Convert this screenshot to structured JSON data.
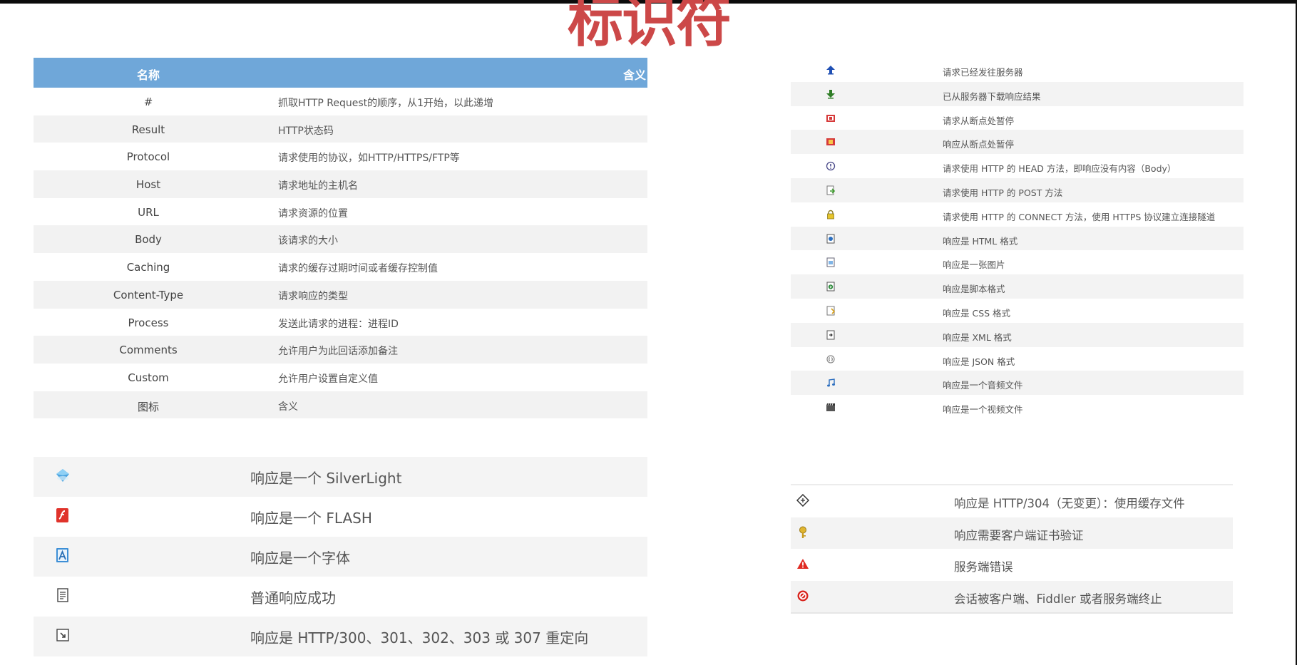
{
  "page": {
    "title": "标识符"
  },
  "columns_table": {
    "header": {
      "name": "名称",
      "meaning": "含义"
    },
    "rows": [
      {
        "name": "#",
        "desc": "抓取HTTP Request的顺序，从1开始，以此递增"
      },
      {
        "name": "Result",
        "desc": "HTTP状态码"
      },
      {
        "name": "Protocol",
        "desc": "请求使用的协议，如HTTP/HTTPS/FTP等"
      },
      {
        "name": "Host",
        "desc": "请求地址的主机名"
      },
      {
        "name": "URL",
        "desc": "请求资源的位置"
      },
      {
        "name": "Body",
        "desc": "该请求的大小"
      },
      {
        "name": "Caching",
        "desc": "请求的缓存过期时间或者缓存控制值"
      },
      {
        "name": "Content-Type",
        "desc": "请求响应的类型"
      },
      {
        "name": "Process",
        "desc": "发送此请求的进程：进程ID"
      },
      {
        "name": "Comments",
        "desc": "允许用户为此回话添加备注"
      },
      {
        "name": "Custom",
        "desc": "允许用户设置自定义值"
      },
      {
        "name": "图标",
        "desc": "含义"
      }
    ]
  },
  "icon_list_right": [
    {
      "icon": "upload-arrow-icon",
      "text": "请求已经发往服务器"
    },
    {
      "icon": "download-arrow-icon",
      "text": "已从服务器下载响应结果"
    },
    {
      "icon": "request-breakpoint-icon",
      "text": "请求从断点处暂停"
    },
    {
      "icon": "response-breakpoint-icon",
      "text": "响应从断点处暂停"
    },
    {
      "icon": "head-method-icon",
      "text": "请求使用 HTTP 的 HEAD 方法，即响应没有内容（Body）"
    },
    {
      "icon": "post-method-icon",
      "text": "请求使用 HTTP 的 POST 方法"
    },
    {
      "icon": "lock-icon",
      "text": "请求使用 HTTP 的 CONNECT 方法，使用 HTTPS 协议建立连接隧道"
    },
    {
      "icon": "html-file-icon",
      "text": "响应是 HTML 格式"
    },
    {
      "icon": "image-file-icon",
      "text": "响应是一张图片"
    },
    {
      "icon": "script-file-icon",
      "text": "响应是脚本格式"
    },
    {
      "icon": "css-file-icon",
      "text": "响应是 CSS 格式"
    },
    {
      "icon": "xml-file-icon",
      "text": "响应是 XML 格式"
    },
    {
      "icon": "json-file-icon",
      "text": "响应是 JSON 格式"
    },
    {
      "icon": "music-note-icon",
      "text": "响应是一个音频文件"
    },
    {
      "icon": "video-clapper-icon",
      "text": "响应是一个视频文件"
    }
  ],
  "icon_list_bottom_left": [
    {
      "icon": "silverlight-icon",
      "text": "响应是一个 SilverLight"
    },
    {
      "icon": "flash-icon",
      "text": "响应是一个 FLASH"
    },
    {
      "icon": "font-icon",
      "text": "响应是一个字体"
    },
    {
      "icon": "document-icon",
      "text": "普通响应成功"
    },
    {
      "icon": "redirect-icon",
      "text": "响应是 HTTP/300、301、302、303 或 307 重定向"
    }
  ],
  "icon_list_bottom_right": [
    {
      "icon": "cache-icon",
      "text": "响应是 HTTP/304（无变更）：使用缓存文件"
    },
    {
      "icon": "certificate-key-icon",
      "text": "响应需要客户端证书验证"
    },
    {
      "icon": "warning-icon",
      "text": "服务端错误"
    },
    {
      "icon": "blocked-icon",
      "text": "会话被客户端、Fiddler 或者服务端终止"
    }
  ]
}
